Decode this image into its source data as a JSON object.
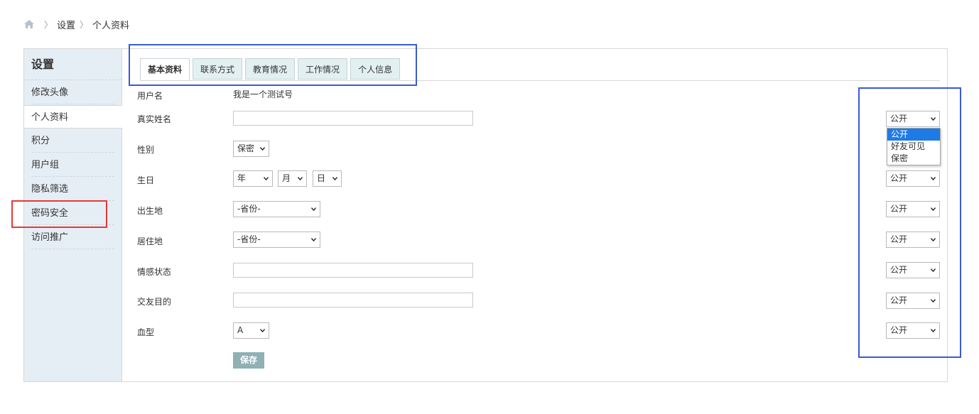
{
  "breadcrumb": {
    "home_icon": "home-icon",
    "items": [
      "设置",
      "个人资料"
    ],
    "separator": "〉"
  },
  "sidebar": {
    "title": "设置",
    "items": [
      {
        "label": "修改头像"
      },
      {
        "label": "个人资料"
      },
      {
        "label": "积分"
      },
      {
        "label": "用户组"
      },
      {
        "label": "隐私筛选"
      },
      {
        "label": "密码安全"
      },
      {
        "label": "访问推广"
      }
    ],
    "active": "个人资料"
  },
  "tabs": [
    {
      "label": "基本资料"
    },
    {
      "label": "联系方式"
    },
    {
      "label": "教育情况"
    },
    {
      "label": "工作情况"
    },
    {
      "label": "个人信息"
    }
  ],
  "form": {
    "username_label": "用户名",
    "username_value": "我是一个测试号",
    "realname_label": "真实姓名",
    "gender_label": "性别",
    "gender_value": "保密",
    "birthday_label": "生日",
    "birth_year": "年",
    "birth_month": "月",
    "birth_day": "日",
    "birthplace_label": "出生地",
    "birthplace_value": "-省份-",
    "residence_label": "居住地",
    "residence_value": "-省份-",
    "emotion_label": "情感状态",
    "purpose_label": "交友目的",
    "blood_label": "血型",
    "blood_value": "A",
    "save_label": "保存"
  },
  "privacy": {
    "value": "公开",
    "options": [
      "公开",
      "好友可见",
      "保密"
    ],
    "highlighted": "公开"
  },
  "colors": {
    "sidebar_bg": "#e6eef5",
    "tab_bg": "#e3f0f1",
    "save_bg": "#8fb0b5",
    "highlight": "#1e7be6",
    "annotation_blue": "#3a5bd0",
    "annotation_red": "#e53935"
  }
}
